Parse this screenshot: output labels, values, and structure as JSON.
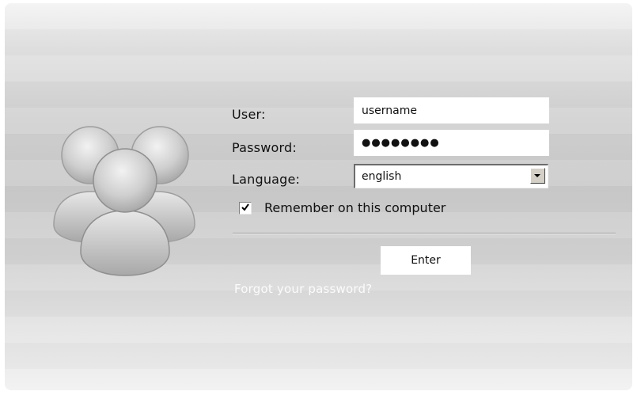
{
  "login": {
    "user_label": "User:",
    "user_value": "username",
    "password_label": "Password:",
    "password_mask": "●●●●●●●●",
    "language_label": "Language:",
    "language_value": "english",
    "remember_label": "Remember on this computer",
    "remember_checked": true,
    "enter_label": "Enter",
    "forgot_link": "Forgot your password?"
  },
  "icons": {
    "avatar": "user-group-icon",
    "dropdown": "chevron-down-icon",
    "check": "checkmark-icon"
  },
  "colors": {
    "panel": "#cbcbcb",
    "field_bg": "#ffffff",
    "link": "#fbfbfb"
  }
}
